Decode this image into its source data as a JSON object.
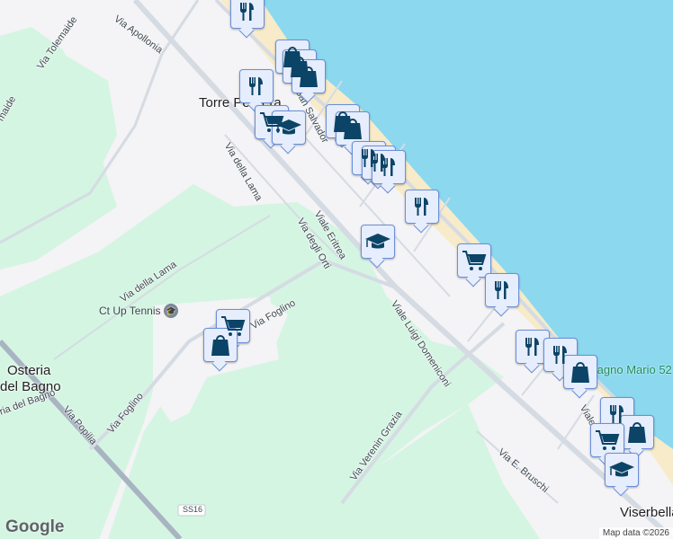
{
  "places": {
    "torre_pedrera": "Torre Pedrera",
    "osteria_del_bagno_1": "Osteria",
    "osteria_del_bagno_2": "del Bagno",
    "viserbella": "Viserbella"
  },
  "streets": {
    "via_tolemaide": "Via Tolemaide",
    "via_tolemaide_partial": "maide",
    "via_apollonia": "Via Apollonia",
    "viale_san_salvador": "Viale San Salvador",
    "via_della_lama_1": "Via della Lama",
    "via_della_lama_2": "Via della Lama",
    "viale_eritrea": "Viale Eritrea",
    "via_degli_orti": "Via degli Orti",
    "viale_luigi_domeniconi": "Viale Luigi Domeniconi",
    "via_foglino_1": "Via Foglino",
    "via_foglino_2": "Via Foglino",
    "via_popilia": "Via Popilia",
    "via_osteria_del_bagno": "ria del Bagno",
    "via_verenin_grazia": "Via Verenin Grazia",
    "via_e_bruschi": "Via E. Bruschi",
    "viale_partial": "Viale",
    "ss16": "SS16"
  },
  "pois": {
    "ct_up_tennis": "Ct Up Tennis",
    "bagno_mario": "Bagno Mario 52"
  },
  "markers": [
    "restaurant-icon",
    "shopping-bag-icon",
    "shopping-bag-icon",
    "shopping-bag-icon",
    "restaurant-icon",
    "shopping-cart-icon",
    "graduation-cap-icon",
    "shopping-bag-icon",
    "shopping-bag-icon",
    "restaurant-icon",
    "restaurant-icon",
    "restaurant-icon",
    "restaurant-icon",
    "graduation-cap-icon",
    "shopping-cart-icon",
    "restaurant-icon",
    "restaurant-icon",
    "restaurant-icon",
    "shopping-bag-icon",
    "restaurant-icon",
    "shopping-bag-icon",
    "shopping-cart-icon",
    "graduation-cap-icon",
    "shopping-cart-icon",
    "shopping-bag-icon"
  ],
  "attribution": "Map data ©2026",
  "logo": "Google",
  "colors": {
    "sea": "#8bd8ef",
    "beach": "#f7ebc9",
    "green": "#d4f5e2",
    "land": "#f4f3f5",
    "road": "#d5dbe3",
    "marker_icon": "#0b4466"
  }
}
